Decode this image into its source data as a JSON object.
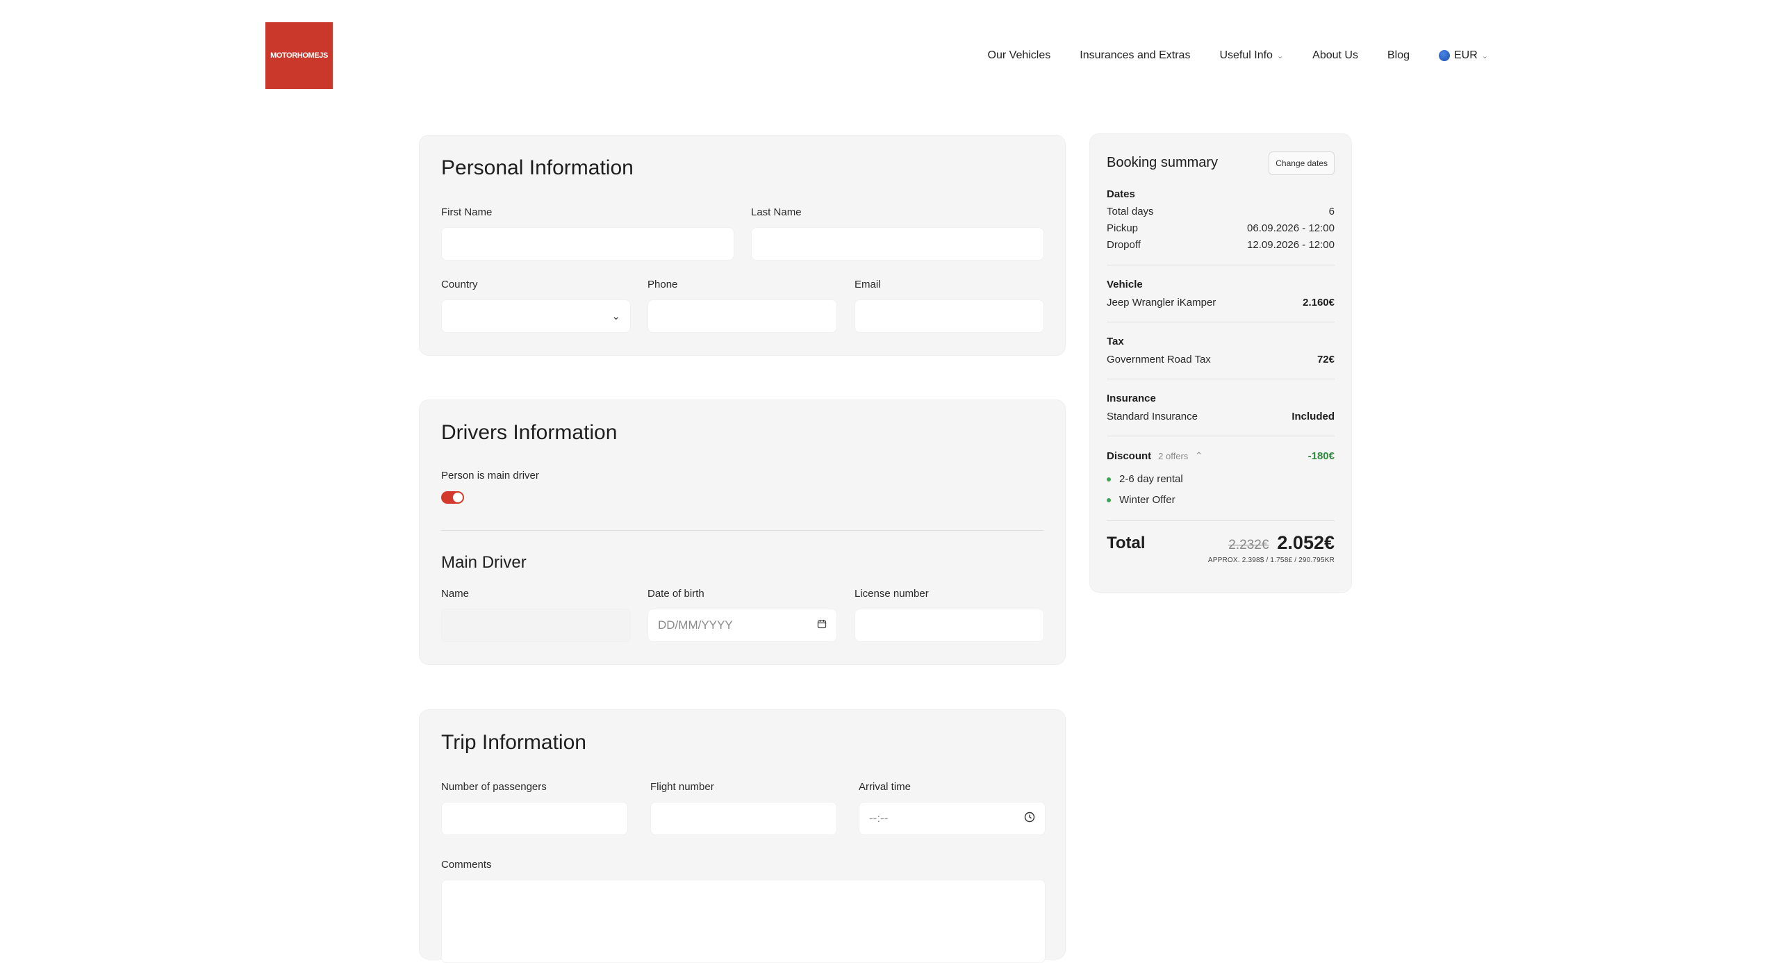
{
  "brand": {
    "logo_text": "MOTORHOMEJS",
    "logo_color": "#c9382b"
  },
  "nav": {
    "items": [
      {
        "label": "Our Vehicles",
        "has_caret": false
      },
      {
        "label": "Insurances and Extras",
        "has_caret": false
      },
      {
        "label": "Useful Info",
        "has_caret": true
      },
      {
        "label": "About Us",
        "has_caret": false
      },
      {
        "label": "Blog",
        "has_caret": false
      }
    ],
    "currency": "EUR"
  },
  "personal": {
    "title": "Personal Information",
    "first_name_label": "First Name",
    "last_name_label": "Last Name",
    "country_label": "Country",
    "phone_label": "Phone",
    "email_label": "Email"
  },
  "drivers": {
    "title": "Drivers Information",
    "main_driver_toggle_label": "Person is main driver",
    "main_driver_toggle_on": true,
    "main_driver_title": "Main Driver",
    "name_label": "Name",
    "dob_label": "Date of birth",
    "dob_placeholder": "DD/MM/YYYY",
    "license_label": "License number"
  },
  "trip": {
    "title": "Trip Information",
    "passengers_label": "Number of passengers",
    "flight_label": "Flight number",
    "arrival_label": "Arrival time",
    "arrival_placeholder": "--:--",
    "comments_label": "Comments"
  },
  "summary": {
    "title": "Booking summary",
    "change_dates": "Change dates",
    "dates_head": "Dates",
    "total_days_label": "Total days",
    "total_days": "6",
    "pickup_label": "Pickup",
    "pickup": "06.09.2026 - 12:00",
    "dropoff_label": "Dropoff",
    "dropoff": "12.09.2026 - 12:00",
    "vehicle_head": "Vehicle",
    "vehicle_name": "Jeep Wrangler iKamper",
    "vehicle_price": "2.160€",
    "tax_head": "Tax",
    "tax_name": "Government Road Tax",
    "tax_price": "72€",
    "insurance_head": "Insurance",
    "insurance_name": "Standard Insurance",
    "insurance_price": "Included",
    "discount_head": "Discount",
    "discount_offers": "2 offers",
    "discount_value": "-180€",
    "discount_items": [
      "2-6 day rental",
      "Winter Offer"
    ],
    "total_label": "Total",
    "total_original": "2.232€",
    "total_final": "2.052€",
    "approx": "APPROX. 2.398$ / 1.758£ / 290.795KR",
    "accent_green": "#2e8b3e"
  }
}
